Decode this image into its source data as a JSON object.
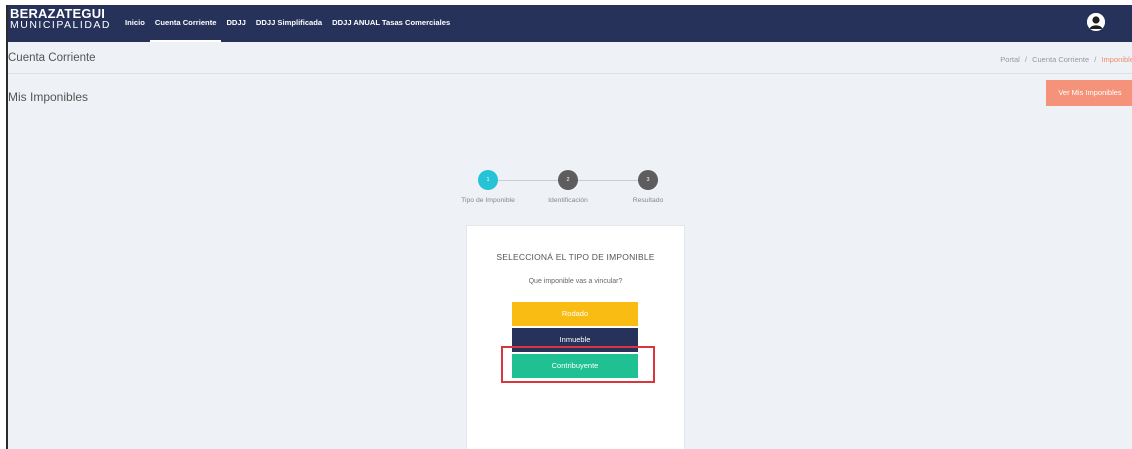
{
  "header": {
    "logo_top": "BERAZATEGUI",
    "logo_bottom": "MUNICIPALIDAD",
    "nav": [
      {
        "label": "Inicio"
      },
      {
        "label": "Cuenta Corriente"
      },
      {
        "label": "DDJJ"
      },
      {
        "label": "DDJJ Simplificada"
      },
      {
        "label": "DDJJ ANUAL Tasas Comerciales"
      }
    ],
    "active_nav": "Cuenta Corriente",
    "avatar_icon": "user-icon"
  },
  "subheader": {
    "title": "Cuenta Corriente",
    "breadcrumb": [
      "Portal",
      "Cuenta Corriente",
      "Imponible"
    ],
    "breadcrumb_separator": "/"
  },
  "main": {
    "section_title": "Mis Imponibles",
    "ver_button": "Ver Mis Imponibles"
  },
  "stepper": {
    "steps": [
      {
        "number": "1",
        "label": "Tipo de Imponible"
      },
      {
        "number": "2",
        "label": "Identificación"
      },
      {
        "number": "3",
        "label": "Resultado"
      }
    ],
    "active_step": 1
  },
  "card": {
    "title": "SELECCIONÁ EL TIPO DE IMPONIBLE",
    "subtitle": "Que imponible vas a vincular?",
    "options": [
      {
        "label": "Rodado"
      },
      {
        "label": "Inmueble"
      },
      {
        "label": "Contribuyente"
      }
    ]
  },
  "colors": {
    "navbar": "#27325b",
    "accent_orange": "#f4937a",
    "breadcrumb_current": "#f08c6c",
    "step_active": "#26c3d6",
    "step_inactive": "#5d5d5d",
    "rodado": "#f8bc13",
    "inmueble": "#27325b",
    "contribuyente": "#1fc192",
    "highlight": "#d9363e"
  }
}
